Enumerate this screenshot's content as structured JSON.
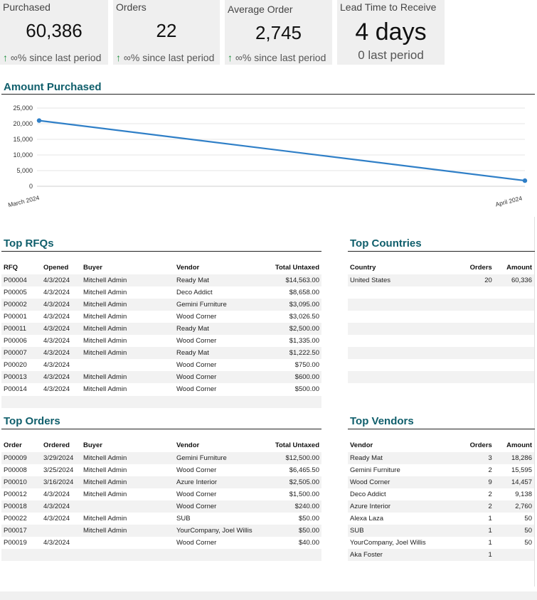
{
  "kpis": [
    {
      "title": "Purchased",
      "value": "60,386",
      "arrow": "↑",
      "delta": "∞% since last period"
    },
    {
      "title": "Orders",
      "value": "22",
      "arrow": "↑",
      "delta": "∞% since last period"
    },
    {
      "title": "Average Order",
      "value": "2,745",
      "arrow": "↑",
      "delta": "∞% since last period"
    },
    {
      "title": "Lead Time to Receive",
      "value": "4 days",
      "arrow": "",
      "delta": "0 last period"
    }
  ],
  "amount_purchased": {
    "title": "Amount Purchased",
    "chart_data": {
      "type": "line",
      "x": [
        "March 2024",
        "April 2024"
      ],
      "series": [
        {
          "values": [
            21000,
            1800
          ]
        }
      ],
      "yticks": [
        "25,000",
        "20,000",
        "15,000",
        "10,000",
        "5,000",
        "0"
      ],
      "ylim": [
        0,
        25000
      ],
      "color": "#2f7fc7",
      "grid": true
    }
  },
  "top_rfqs": {
    "title": "Top RFQs",
    "headers": [
      "RFQ",
      "Opened",
      "Buyer",
      "Vendor",
      "Total Untaxed"
    ],
    "rows": [
      [
        "P00004",
        "4/3/2024",
        "Mitchell Admin",
        "Ready Mat",
        "$14,563.00"
      ],
      [
        "P00005",
        "4/3/2024",
        "Mitchell Admin",
        "Deco Addict",
        "$8,658.00"
      ],
      [
        "P00002",
        "4/3/2024",
        "Mitchell Admin",
        "Gemini Furniture",
        "$3,095.00"
      ],
      [
        "P00001",
        "4/3/2024",
        "Mitchell Admin",
        "Wood Corner",
        "$3,026.50"
      ],
      [
        "P00011",
        "4/3/2024",
        "Mitchell Admin",
        "Ready Mat",
        "$2,500.00"
      ],
      [
        "P00006",
        "4/3/2024",
        "Mitchell Admin",
        "Wood Corner",
        "$1,335.00"
      ],
      [
        "P00007",
        "4/3/2024",
        "Mitchell Admin",
        "Ready Mat",
        "$1,222.50"
      ],
      [
        "P00020",
        "4/3/2024",
        "",
        "Wood Corner",
        "$750.00"
      ],
      [
        "P00013",
        "4/3/2024",
        "Mitchell Admin",
        "Wood Corner",
        "$600.00"
      ],
      [
        "P00014",
        "4/3/2024",
        "Mitchell Admin",
        "Wood Corner",
        "$500.00"
      ]
    ]
  },
  "top_countries": {
    "title": "Top Countries",
    "headers": [
      "Country",
      "Orders",
      "Amount"
    ],
    "rows": [
      [
        "United States",
        "20",
        "60,336"
      ]
    ]
  },
  "top_orders": {
    "title": "Top Orders",
    "headers": [
      "Order",
      "Ordered",
      "Buyer",
      "Vendor",
      "Total Untaxed"
    ],
    "rows": [
      [
        "P00009",
        "3/29/2024",
        "Mitchell Admin",
        "Gemini Furniture",
        "$12,500.00"
      ],
      [
        "P00008",
        "3/25/2024",
        "Mitchell Admin",
        "Wood Corner",
        "$6,465.50"
      ],
      [
        "P00010",
        "3/16/2024",
        "Mitchell Admin",
        "Azure Interior",
        "$2,505.00"
      ],
      [
        "P00012",
        "4/3/2024",
        "Mitchell Admin",
        "Wood Corner",
        "$1,500.00"
      ],
      [
        "P00018",
        "4/3/2024",
        "",
        "Wood Corner",
        "$240.00"
      ],
      [
        "P00022",
        "4/3/2024",
        "Mitchell Admin",
        "SUB",
        "$50.00"
      ],
      [
        "P00017",
        "",
        "Mitchell Admin",
        "YourCompany, Joel Willis",
        "$50.00"
      ],
      [
        "P00019",
        "4/3/2024",
        "",
        "Wood Corner",
        "$40.00"
      ]
    ]
  },
  "top_vendors": {
    "title": "Top Vendors",
    "headers": [
      "Vendor",
      "Orders",
      "Amount"
    ],
    "rows": [
      [
        "Ready Mat",
        "3",
        "18,286"
      ],
      [
        "Gemini Furniture",
        "2",
        "15,595"
      ],
      [
        "Wood Corner",
        "9",
        "14,457"
      ],
      [
        "Deco Addict",
        "2",
        "9,138"
      ],
      [
        "Azure Interior",
        "2",
        "2,760"
      ],
      [
        "Alexa Laza",
        "1",
        "50"
      ],
      [
        "SUB",
        "1",
        "50"
      ],
      [
        "YourCompany, Joel Willis",
        "1",
        "50"
      ],
      [
        "Aka Foster",
        "1",
        ""
      ]
    ]
  }
}
